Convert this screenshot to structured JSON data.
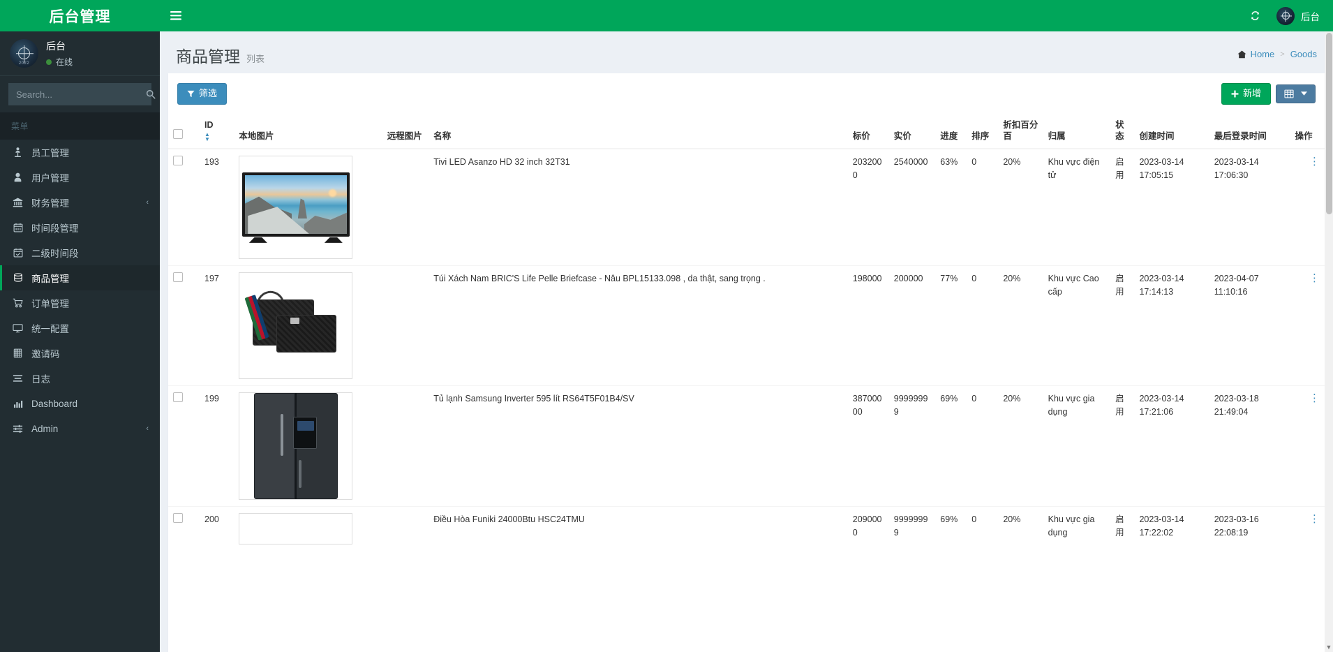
{
  "brand": {
    "title": "后台管理"
  },
  "sidebar": {
    "user": {
      "name": "后台",
      "status": "在线",
      "avatar_year": "2022"
    },
    "search": {
      "placeholder": "Search...",
      "value": ""
    },
    "menu_header": "菜单",
    "items": [
      {
        "label": "员工管理",
        "icon": "employee-icon",
        "active": false,
        "caret": ""
      },
      {
        "label": "用户管理",
        "icon": "user-icon",
        "active": false,
        "caret": ""
      },
      {
        "label": "财务管理",
        "icon": "bank-icon",
        "active": false,
        "caret": "‹"
      },
      {
        "label": "时间段管理",
        "icon": "calendar-icon",
        "active": false,
        "caret": ""
      },
      {
        "label": "二级时间段",
        "icon": "calendar-check-icon",
        "active": false,
        "caret": ""
      },
      {
        "label": "商品管理",
        "icon": "database-icon",
        "active": true,
        "caret": ""
      },
      {
        "label": "订单管理",
        "icon": "cart-icon",
        "active": false,
        "caret": ""
      },
      {
        "label": "统一配置",
        "icon": "monitor-icon",
        "active": false,
        "caret": ""
      },
      {
        "label": "邀请码",
        "icon": "grid-icon",
        "active": false,
        "caret": ""
      },
      {
        "label": "日志",
        "icon": "list-icon",
        "active": false,
        "caret": ""
      },
      {
        "label": "Dashboard",
        "icon": "chart-bar-icon",
        "active": false,
        "caret": ""
      },
      {
        "label": "Admin",
        "icon": "sliders-icon",
        "active": false,
        "caret": "‹"
      }
    ]
  },
  "topbar": {
    "menu_toggle": "☰",
    "refresh_icon": "refresh-icon",
    "user_label": "后台"
  },
  "page": {
    "title": "商品管理",
    "subtitle": "列表",
    "breadcrumb": {
      "home": "Home",
      "separator": ">",
      "current": "Goods"
    }
  },
  "toolbar": {
    "filter_label": "筛选",
    "add_label": "新增",
    "columns_label": ""
  },
  "table": {
    "headers": {
      "select": "",
      "id": "ID",
      "local_image": "本地图片",
      "remote_image": "远程图片",
      "name": "名称",
      "list_price": "标价",
      "real_price": "实价",
      "progress": "进度",
      "sort": "排序",
      "discount": "折扣百分百",
      "belong": "归属",
      "status": "状态",
      "created_at": "创建时间",
      "last_login": "最后登录时间",
      "actions": "操作"
    },
    "rows": [
      {
        "id": "193",
        "image": "tv",
        "name": "Tivi LED Asanzo HD 32 inch 32T31",
        "list_price": "2032000",
        "real_price": "2540000",
        "progress": "63%",
        "sort": "0",
        "discount": "20%",
        "belong": "Khu vực điện tử",
        "status": "启用",
        "created_at": "2023-03-14 17:05:15",
        "last_login": "2023-03-14 17:06:30"
      },
      {
        "id": "197",
        "image": "bag",
        "name": "Túi Xách Nam BRIC'S Life Pelle Briefcase - Nâu BPL15133.098 , da thật, sang trọng .",
        "list_price": "198000",
        "real_price": "200000",
        "progress": "77%",
        "sort": "0",
        "discount": "20%",
        "belong": "Khu vực Cao cấp",
        "status": "启用",
        "created_at": "2023-03-14 17:14:13",
        "last_login": "2023-04-07 11:10:16"
      },
      {
        "id": "199",
        "image": "fridge",
        "name": "Tủ lạnh Samsung Inverter 595 lít RS64T5F01B4/SV",
        "list_price": "38700000",
        "real_price": "99999999",
        "progress": "69%",
        "sort": "0",
        "discount": "20%",
        "belong": "Khu vực gia dụng",
        "status": "启用",
        "created_at": "2023-03-14 17:21:06",
        "last_login": "2023-03-18 21:49:04"
      },
      {
        "id": "200",
        "image": "none",
        "name": "Điều Hòa Funiki 24000Btu HSC24TMU",
        "list_price": "2090000",
        "real_price": "99999999",
        "progress": "69%",
        "sort": "0",
        "discount": "20%",
        "belong": "Khu vực gia dụng",
        "status": "启用",
        "created_at": "2023-03-14 17:22:02",
        "last_login": "2023-03-16 22:08:19"
      }
    ],
    "row_action_icon": "⋮"
  },
  "colors": {
    "brand_green": "#00a65a",
    "sidebar_dark": "#222d32",
    "primary_blue": "#3c8dbc",
    "content_bg": "#ecf0f5"
  }
}
